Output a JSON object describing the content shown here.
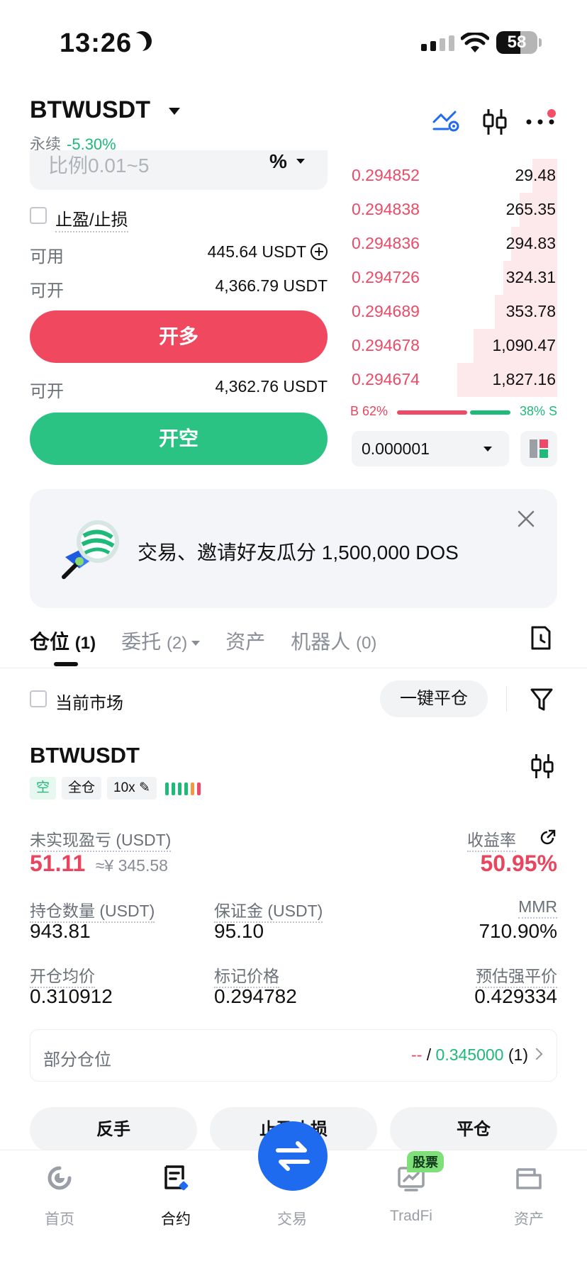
{
  "status_bar": {
    "time": "13:26",
    "battery": "58",
    "battery_level": 0.58
  },
  "header": {
    "pair": "BTWUSDT",
    "type": "永续",
    "change": "-5.30%"
  },
  "order_form": {
    "ratio_placeholder": "比例0.01~5",
    "ratio_unit": "%",
    "tpsl_label": "止盈/止损",
    "available_label": "可用",
    "available_value": "445.64 USDT",
    "openable_label": "可开",
    "openable_long_value": "4,366.79 USDT",
    "long_button": "开多",
    "openable_short_label": "可开",
    "openable_short_value": "4,362.76 USDT",
    "short_button": "开空"
  },
  "order_book": {
    "asks": [
      {
        "price": "0.294852",
        "qty": "29.48",
        "depth": 0.12
      },
      {
        "price": "0.294838",
        "qty": "265.35",
        "depth": 0.18
      },
      {
        "price": "0.294836",
        "qty": "294.83",
        "depth": 0.22
      },
      {
        "price": "0.294726",
        "qty": "324.31",
        "depth": 0.26
      },
      {
        "price": "0.294689",
        "qty": "353.78",
        "depth": 0.3
      },
      {
        "price": "0.294678",
        "qty": "1,090.47",
        "depth": 0.4
      },
      {
        "price": "0.294674",
        "qty": "1,827.16",
        "depth": 0.48
      }
    ],
    "buy_ratio_label": "B 62%",
    "sell_ratio_label": "38% S",
    "buy_ratio": 0.62,
    "tick_size": "0.000001"
  },
  "banner": {
    "text": "交易、邀请好友瓜分 1,500,000 DOS"
  },
  "tabs": [
    {
      "label": "仓位",
      "count": "(1)"
    },
    {
      "label": "委托",
      "count": "(2)"
    },
    {
      "label": "资产",
      "count": ""
    },
    {
      "label": "机器人",
      "count": "(0)"
    }
  ],
  "filter": {
    "current_market": "当前市场",
    "close_all": "一键平仓"
  },
  "position": {
    "symbol": "BTWUSDT",
    "side": "空",
    "margin_mode": "全仓",
    "leverage": "10x",
    "upnl_label": "未实现盈亏 (USDT)",
    "upnl_value": "51.11",
    "upnl_cny": "≈¥ 345.58",
    "roe_label": "收益率",
    "roe_value": "50.95%",
    "size_label": "持仓数量 (USDT)",
    "size_value": "943.81",
    "margin_label": "保证金 (USDT)",
    "margin_value": "95.10",
    "mmr_label": "MMR",
    "mmr_value": "710.90%",
    "entry_label": "开仓均价",
    "entry_value": "0.310912",
    "mark_label": "标记价格",
    "mark_value": "0.294782",
    "liq_label": "预估强平价",
    "liq_value": "0.429334",
    "partial_label": "部分仓位",
    "partial_dash": "--",
    "partial_sep": " / ",
    "partial_price": "0.345000",
    "partial_count": "(1)"
  },
  "actions": {
    "reverse": "反手",
    "tpsl": "止盈止损",
    "close": "平仓"
  },
  "nav": [
    {
      "label": "首页"
    },
    {
      "label": "合约"
    },
    {
      "label": "交易"
    },
    {
      "label": "TradFi",
      "badge": "股票"
    },
    {
      "label": "资产"
    }
  ],
  "colors": {
    "red": "#e8455f",
    "green": "#1fb97a",
    "blue": "#1f6bf0",
    "orange": "#f39a40"
  }
}
